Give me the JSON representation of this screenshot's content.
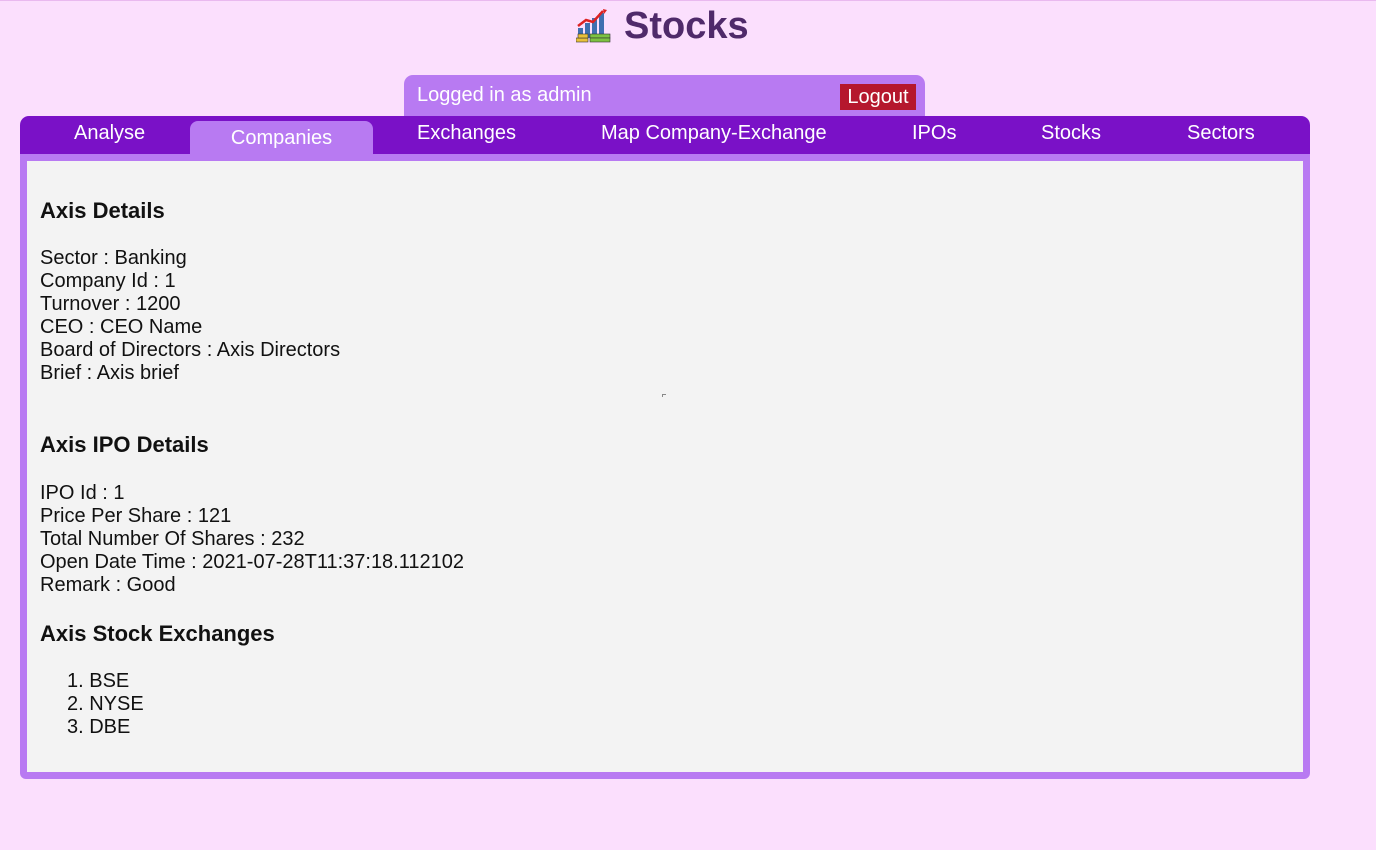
{
  "app": {
    "title": "Stocks",
    "icon": "stock-chart-icon"
  },
  "userbar": {
    "status": "Logged in as admin",
    "logout_label": "Logout"
  },
  "nav": {
    "items": [
      "Analyse",
      "Companies",
      "Exchanges",
      "Map Company-Exchange",
      "IPOs",
      "Stocks",
      "Sectors"
    ],
    "active": "Companies"
  },
  "company": {
    "details_title": "Axis Details",
    "sector": "Sector : Banking",
    "company_id": "Company Id : 1",
    "turnover": "Turnover : 1200",
    "ceo": "CEO : CEO Name",
    "board": "Board of Directors : Axis Directors",
    "brief": "Brief : Axis brief"
  },
  "ipo": {
    "title": "Axis IPO Details",
    "ipo_id": "IPO Id : 1",
    "price_per_share": "Price Per Share : 121",
    "total_shares": "Total Number Of Shares : 232",
    "open_date_time": "Open Date Time : 2021-07-28T11:37:18.112102",
    "remark": "Remark : Good"
  },
  "exchanges": {
    "title": "Axis Stock Exchanges",
    "items": [
      "1. BSE",
      "2. NYSE",
      "3. DBE"
    ]
  },
  "colors": {
    "page_bg": "#fbdffd",
    "nav_bg": "#7a11c7",
    "accent": "#b87af2",
    "logout_bg": "#b5172d",
    "title_color": "#4f2a6a",
    "panel_bg": "#f3f3f3"
  }
}
